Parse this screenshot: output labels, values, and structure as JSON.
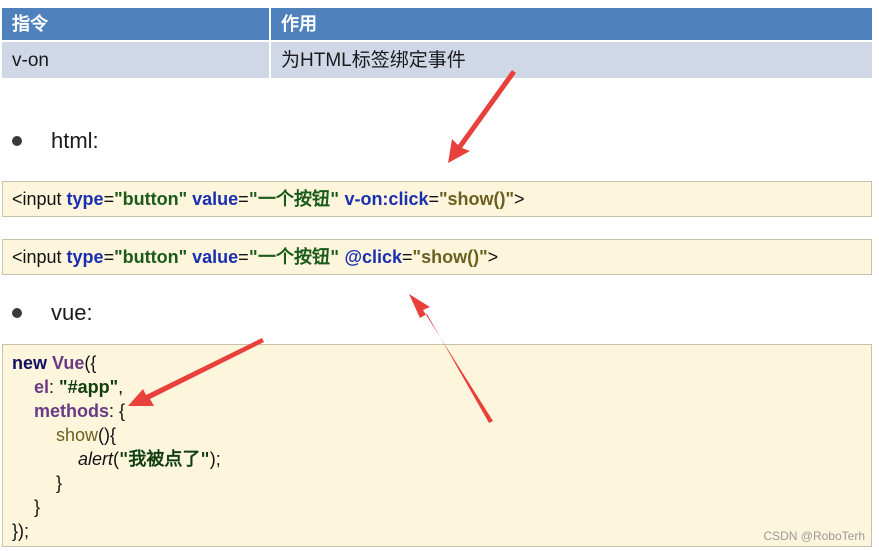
{
  "table": {
    "headers": [
      "指令",
      "作用"
    ],
    "rows": [
      [
        "v-on",
        "为HTML标签绑定事件"
      ]
    ]
  },
  "bullets": {
    "html": "html:",
    "vue": "vue:"
  },
  "code1": {
    "open": "<input ",
    "attr_type": "type",
    "eq1": "=",
    "val_type": "\"button\"",
    "attr_value": " value",
    "eq2": "=",
    "val_value": "\"一个按钮\"",
    "directive": " v-on:click",
    "eq3": "=",
    "handler": "\"show()\"",
    "close": ">"
  },
  "code2": {
    "open": "<input ",
    "attr_type": "type",
    "eq1": "=",
    "val_type": "\"button\"",
    "attr_value": " value",
    "eq2": "=",
    "val_value": "\"一个按钮\"",
    "directive": " @click",
    "eq3": "=",
    "handler": "\"show()\"",
    "close": ">"
  },
  "vue_code": {
    "l1_new": "new ",
    "l1_vue": "Vue",
    "l1_rest": "({",
    "l2_key": "el",
    "l2_colon": ": ",
    "l2_val": "\"#app\"",
    "l2_end": ",",
    "l3_key": "methods",
    "l3_rest": ": {",
    "l4_fn": "show",
    "l4_rest": "(){",
    "l5_fn": "alert",
    "l5_open": "(",
    "l5_str": "\"我被点了\"",
    "l5_end": ");",
    "l6": "}",
    "l7": "}",
    "l8": "});"
  },
  "watermark": "CSDN @RoboTerh",
  "colors": {
    "header_bg": "#4f81bd",
    "row_bg": "#d0d8e8",
    "code_bg": "#fdf6dc",
    "arrow": "#e8403a"
  }
}
